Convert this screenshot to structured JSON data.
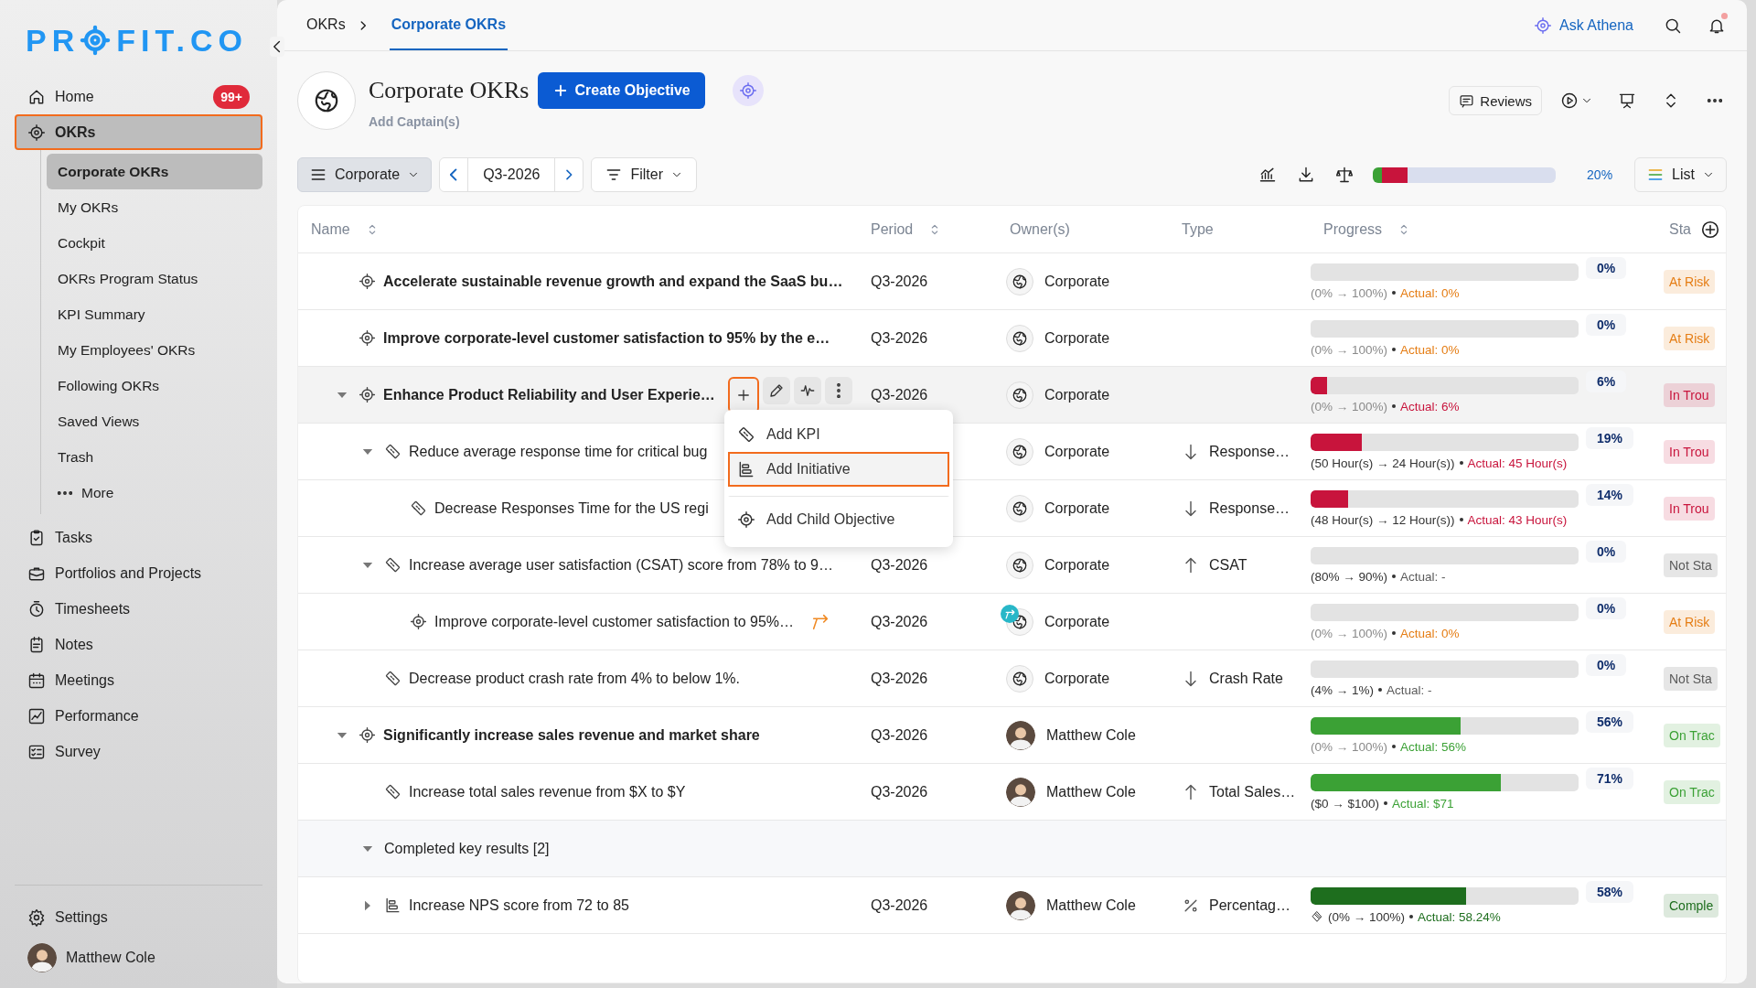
{
  "sidebar": {
    "logo": {
      "before": "PR",
      "after": "FIT.CO"
    },
    "items": [
      {
        "label": "Home",
        "badge": "99+",
        "selected": false,
        "highlighted": false
      },
      {
        "label": "OKRs",
        "selected": true,
        "highlighted": true,
        "expanded": true,
        "children": [
          {
            "kind": "link",
            "label": "Corporate OKRs",
            "selected": true
          },
          {
            "kind": "link",
            "label": "My OKRs",
            "selected": false
          },
          {
            "kind": "link",
            "label": "Cockpit",
            "selected": false
          },
          {
            "kind": "link",
            "label": "OKRs Program Status",
            "selected": false
          },
          {
            "kind": "link",
            "label": "KPI Summary",
            "selected": false
          },
          {
            "kind": "link",
            "label": "My Employees' OKRs",
            "selected": false
          },
          {
            "kind": "link",
            "label": "Following OKRs",
            "selected": false
          },
          {
            "kind": "link",
            "label": "Saved Views",
            "selected": false
          },
          {
            "kind": "link",
            "label": "Trash",
            "selected": false
          },
          {
            "kind": "more",
            "label": "More",
            "selected": false
          }
        ]
      },
      {
        "label": "Tasks",
        "selected": false,
        "highlighted": false
      },
      {
        "label": "Portfolios and Projects",
        "selected": false,
        "highlighted": false
      },
      {
        "label": "Timesheets",
        "selected": false,
        "highlighted": false
      },
      {
        "label": "Notes",
        "selected": false,
        "highlighted": false
      },
      {
        "label": "Meetings",
        "selected": false,
        "highlighted": false
      },
      {
        "label": "Performance",
        "selected": false,
        "highlighted": false
      },
      {
        "label": "Survey",
        "selected": false,
        "highlighted": false
      }
    ],
    "footer": [
      {
        "kind": "settings",
        "label": "Settings"
      },
      {
        "kind": "user",
        "label": "Matthew Cole"
      }
    ]
  },
  "breadcrumb": [
    {
      "label": "OKRs",
      "selected": false
    },
    {
      "label": "Corporate OKRs",
      "selected": true
    }
  ],
  "top_actions": {
    "assistant": "Ask Athena",
    "notification": true
  },
  "header": {
    "title": "Corporate OKRs",
    "create_button": "Create Objective",
    "captains": "Add Captain(s)",
    "reviews_button": "Reviews"
  },
  "toolbar": {
    "scope": "Corporate",
    "period": "Q3-2026",
    "filter": "Filter",
    "view": "List",
    "progress": {
      "reading": "20%",
      "segments": [
        {
          "color": "#3ba135",
          "level": 0.05
        },
        {
          "color": "#c8143c",
          "level": 0.14
        }
      ]
    }
  },
  "table": {
    "columns": [
      {
        "label": "Name",
        "sortable": true
      },
      {
        "label": "Period",
        "sortable": true
      },
      {
        "label": "Owner(s)",
        "sortable": false
      },
      {
        "label": "Type",
        "sortable": false
      },
      {
        "label": "Progress",
        "sortable": true
      },
      {
        "label": "Sta",
        "sortable": false
      }
    ],
    "rows": [
      {
        "kind": "objective",
        "name": "Accelerate sustainable revenue growth and expand the SaaS bu…",
        "period": "Q3-2026",
        "owner": {
          "kind": "org",
          "name": "Corporate"
        },
        "level": 0,
        "percent": "0%",
        "range": "(0% → 100%)",
        "actual": "Actual: 0%",
        "status": "At Risk",
        "color": "#e57d14",
        "hovered": false
      },
      {
        "kind": "objective",
        "name": "Improve corporate-level customer satisfaction to 95% by the e…",
        "period": "Q3-2026",
        "owner": {
          "kind": "org",
          "name": "Corporate"
        },
        "level": 0,
        "percent": "0%",
        "range": "(0% → 100%)",
        "actual": "Actual: 0%",
        "status": "At Risk",
        "color": "#e57d14",
        "hovered": false
      },
      {
        "kind": "objective",
        "name": "Enhance Product Reliability and User Experie…",
        "period": "Q3-2026",
        "owner": {
          "kind": "org",
          "name": "Corporate"
        },
        "level": 0.06,
        "percent": "6%",
        "range": "(0% → 100%)",
        "actual": "Actual: 6%",
        "status": "In Trou",
        "color": "#c8143c",
        "hovered": true,
        "expanded": true,
        "actions": [
          {
            "kind": "plus",
            "highlighted": true
          },
          {
            "kind": "pencil",
            "highlighted": false
          },
          {
            "kind": "checkin",
            "highlighted": false
          },
          {
            "kind": "kebab",
            "highlighted": false
          }
        ],
        "children": [
          {
            "kind": "key_result",
            "name": "Reduce average response time for critical bug",
            "owner": {
              "kind": "org",
              "name": "Corporate"
            },
            "type": {
              "kind": "down",
              "label": "Response…"
            },
            "level": 0.19,
            "percent": "19%",
            "range": "(50 Hour(s) → 24 Hour(s))",
            "actual": "Actual: 45 Hour(s)",
            "status": "In Trou",
            "color": "#c8143c",
            "hovered": false,
            "expanded": true,
            "children": [
              {
                "kind": "key_result",
                "name": "Decrease Responses Time for the US regi",
                "owner": {
                  "kind": "org",
                  "name": "Corporate"
                },
                "type": {
                  "kind": "down",
                  "label": "Response…"
                },
                "level": 0.14,
                "percent": "14%",
                "range": "(48 Hour(s) → 12 Hour(s))",
                "actual": "Actual: 43 Hour(s)",
                "status": "In Trou",
                "color": "#c8143c",
                "hovered": false
              }
            ]
          },
          {
            "kind": "key_result",
            "name": "Increase average user satisfaction (CSAT) score from 78% to 9…",
            "period": "Q3-2026",
            "owner": {
              "kind": "org",
              "name": "Corporate"
            },
            "type": {
              "kind": "up",
              "label": "CSAT"
            },
            "level": 0,
            "percent": "0%",
            "range": "(80% → 90%)",
            "actual": "Actual: -",
            "status": "Not Sta",
            "color": "#5a5a5a",
            "hovered": false,
            "expanded": true,
            "children": [
              {
                "kind": "aligned_objective",
                "name": "Improve corporate-level customer satisfaction to 95%…",
                "period": "Q3-2026",
                "owner": {
                  "kind": "org",
                  "name": "Corporate"
                },
                "level": 0,
                "percent": "0%",
                "range": "(0% → 100%)",
                "actual": "Actual: 0%",
                "status": "At Risk",
                "color": "#e57d14",
                "hovered": false
              }
            ]
          },
          {
            "kind": "key_result",
            "name": "Decrease product crash rate from 4% to below 1%.",
            "period": "Q3-2026",
            "owner": {
              "kind": "org",
              "name": "Corporate"
            },
            "type": {
              "kind": "down",
              "label": "Crash Rate"
            },
            "level": 0,
            "percent": "0%",
            "range": "(4% → 1%)",
            "actual": "Actual: -",
            "status": "Not Sta",
            "color": "#5a5a5a",
            "hovered": false
          }
        ]
      },
      {
        "kind": "objective",
        "name": "Significantly increase sales revenue and market share",
        "period": "Q3-2026",
        "owner": {
          "kind": "person",
          "name": "Matthew Cole"
        },
        "level": 0.56,
        "percent": "56%",
        "range": "(0% → 100%)",
        "actual": "Actual: 56%",
        "status": "On Trac",
        "color": "#3ba135",
        "hovered": false,
        "expanded": true,
        "children": [
          {
            "kind": "key_result",
            "name": "Increase total sales revenue from $X to $Y",
            "period": "Q3-2026",
            "owner": {
              "kind": "person",
              "name": "Matthew Cole"
            },
            "type": {
              "kind": "up",
              "label": "Total Sales…"
            },
            "level": 0.71,
            "percent": "71%",
            "range": "($0 → $100)",
            "actual": "Actual: $71",
            "status": "On Trac",
            "color": "#3ba135",
            "hovered": false
          },
          {
            "kind": "group",
            "name": "Completed key results [2]",
            "expanded": true,
            "hovered": false,
            "children": [
              {
                "kind": "initiative",
                "name": "Increase NPS score from 72 to 85",
                "period": "Q3-2026",
                "owner": {
                  "kind": "person",
                  "name": "Matthew Cole"
                },
                "type": {
                  "kind": "percent",
                  "label": "Percentag…"
                },
                "level": 0.58,
                "percent": "58%",
                "range": "(0% → 100%)",
                "actual": "Actual: 58.24%",
                "status": "Comple",
                "color": "#1e6e1e",
                "hovered": false,
                "expanded": false
              }
            ]
          }
        ]
      }
    ],
    "menu": {
      "items": [
        {
          "kind": "kpi",
          "label": "Add KPI",
          "highlighted": false,
          "separated": false
        },
        {
          "kind": "initiative",
          "label": "Add Initiative",
          "highlighted": true,
          "separated": false
        },
        {
          "kind": "child_objective",
          "label": "Add Child Objective",
          "highlighted": false,
          "separated": true
        }
      ]
    }
  }
}
